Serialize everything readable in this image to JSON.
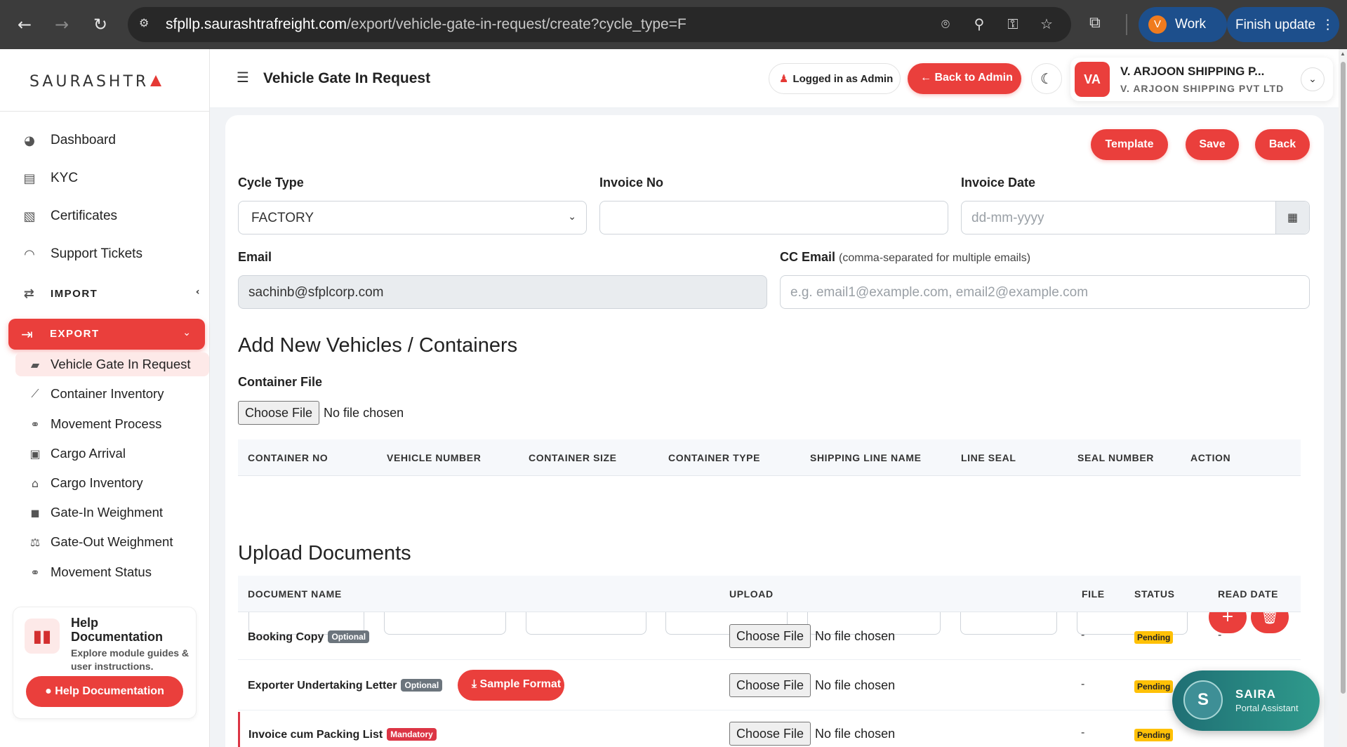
{
  "browser": {
    "url_host": "sfpllp.saurashtrafreight.com",
    "url_path": "/export/vehicle-gate-in-request/create?cycle_type=F",
    "profile_initial": "V",
    "profile_label": "Work",
    "update_label": "Finish update"
  },
  "brand": {
    "logo_text": "SAURASHTR"
  },
  "sidebar": {
    "items": [
      {
        "label": "Dashboard",
        "icon": "palette-icon"
      },
      {
        "label": "KYC",
        "icon": "id-card-icon"
      },
      {
        "label": "Certificates",
        "icon": "certificate-icon"
      },
      {
        "label": "Support Tickets",
        "icon": "headset-icon"
      },
      {
        "label": "IMPORT",
        "icon": "exchange-icon"
      },
      {
        "label": "EXPORT",
        "icon": "file-export-icon"
      }
    ],
    "export_sub": [
      {
        "label": "Vehicle Gate In Request",
        "icon": "folder-open-icon"
      },
      {
        "label": "Container Inventory",
        "icon": "chart-line-icon"
      },
      {
        "label": "Movement Process",
        "icon": "route-icon"
      },
      {
        "label": "Cargo Arrival",
        "icon": "truck-loading-icon"
      },
      {
        "label": "Cargo Inventory",
        "icon": "warehouse-icon"
      },
      {
        "label": "Gate-In Weighment",
        "icon": "truck-icon"
      },
      {
        "label": "Gate-Out Weighment",
        "icon": "balance-scale-icon"
      },
      {
        "label": "Movement Status",
        "icon": "route-icon"
      }
    ],
    "help": {
      "title": "Help Documentation",
      "subtitle": "Explore module guides & user instructions.",
      "button": "Help Documentation"
    }
  },
  "header": {
    "title": "Vehicle Gate In Request",
    "logged_in": "Logged in as Admin",
    "back_admin": "Back to Admin",
    "user_initials": "VA",
    "user_name": "V. ARJOON SHIPPING P...",
    "user_company": "V. ARJOON SHIPPING PVT LTD"
  },
  "actions": {
    "template": "Template",
    "save": "Save",
    "back": "Back"
  },
  "form": {
    "cycle_type_label": "Cycle Type",
    "cycle_type_value": "FACTORY",
    "invoice_no_label": "Invoice No",
    "invoice_no_value": "",
    "invoice_date_label": "Invoice Date",
    "invoice_date_placeholder": "dd-mm-yyyy",
    "email_label": "Email",
    "email_value": "sachinb@sfplcorp.com",
    "cc_email_label": "CC Email",
    "cc_email_note": "(comma-separated for multiple emails)",
    "cc_email_placeholder": "e.g. email1@example.com, email2@example.com"
  },
  "vehicles": {
    "title": "Add New Vehicles / Containers",
    "container_file_label": "Container File",
    "choose_file": "Choose File",
    "no_file": "No file chosen",
    "columns": [
      "CONTAINER NO",
      "VEHICLE NUMBER",
      "CONTAINER SIZE",
      "CONTAINER TYPE",
      "SHIPPING LINE NAME",
      "LINE SEAL",
      "SEAL NUMBER",
      "ACTION"
    ]
  },
  "documents": {
    "title": "Upload Documents",
    "columns": [
      "DOCUMENT NAME",
      "UPLOAD",
      "FILE",
      "STATUS",
      "READ DATE"
    ],
    "rows": [
      {
        "name": "Booking Copy",
        "badge": "Optional",
        "file": "-",
        "status": "Pending",
        "read_date": "-"
      },
      {
        "name": "Exporter Undertaking Letter",
        "badge": "Optional",
        "sample": "Sample Format",
        "file": "-",
        "status": "Pending",
        "read_date": ""
      },
      {
        "name": "Invoice cum Packing List",
        "badge": "Mandatory",
        "file": "-",
        "status": "Pending",
        "read_date": ""
      }
    ]
  },
  "assistant": {
    "initial": "S",
    "name": "SAIRA",
    "subtitle": "Portal Assistant"
  }
}
